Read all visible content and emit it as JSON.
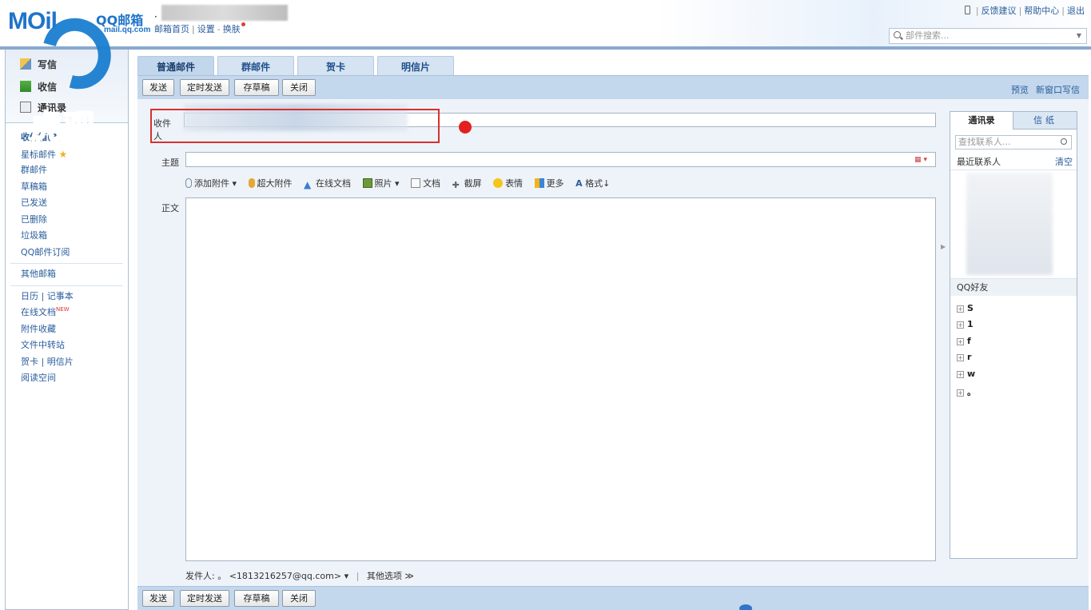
{
  "header": {
    "logo_main": "MOil",
    "logo_qq": "QQ邮箱",
    "logo_domain": "mail.qq.com",
    "user_dot": "·",
    "links": [
      "邮箱首页",
      "设置",
      "换肤"
    ],
    "top_right": [
      "反馈建议",
      "帮助中心",
      "退出"
    ],
    "mail_search_placeholder": "部件搜索..."
  },
  "watermark": {
    "text": "虎观"
  },
  "sidebar": {
    "top_rows": [
      "写信",
      "收信",
      "通讯录"
    ],
    "items": [
      {
        "label": "收件箱(3)",
        "bold": true
      },
      {
        "label": "星标邮件"
      },
      {
        "label": "群邮件"
      },
      {
        "label": "草稿箱"
      },
      {
        "label": "已发送"
      },
      {
        "label": "已删除"
      },
      {
        "label": "垃圾箱"
      },
      {
        "label": "QQ邮件订阅"
      },
      {
        "label": "其他邮箱"
      },
      {
        "label": "日历 | 记事本"
      },
      {
        "label": "在线文档",
        "badge": "NEW"
      },
      {
        "label": "附件收藏"
      },
      {
        "label": "文件中转站"
      },
      {
        "label": "贺卡 | 明信片"
      },
      {
        "label": "阅读空间"
      }
    ]
  },
  "tabs": [
    "普通邮件",
    "群邮件",
    "贺卡",
    "明信片"
  ],
  "toolbar": {
    "send": "发送",
    "schedule": "定时发送",
    "draft": "存草稿",
    "close": "关闭",
    "preview": "预览",
    "new_window": "新窗口写信"
  },
  "compose": {
    "to_label": "收件人",
    "subject_label": "主题",
    "body_label": "正文",
    "attach_items": [
      "添加附件",
      "超大附件",
      "在线文档",
      "照片",
      "文档",
      "截屏",
      "表情",
      "更多",
      "格式"
    ],
    "sender_label": "发件人:",
    "sender_value": "。 <1813216257@qq.com>",
    "other_options": "其他选项"
  },
  "right_panel": {
    "tab_contacts": "通讯录",
    "tab_letter": "信纸",
    "search_placeholder": "查找联系人...",
    "recent_label": "最近联系人",
    "clear_label": "清空",
    "qq_friends": "QQ好友",
    "groups": [
      "S",
      "1",
      "f",
      "r",
      "w",
      "。"
    ]
  },
  "colors": {
    "accent": "#1f74c9",
    "link": "#2a5d9c",
    "toolbar": "#c3d7ed",
    "highlight_box": "#d9302f"
  }
}
